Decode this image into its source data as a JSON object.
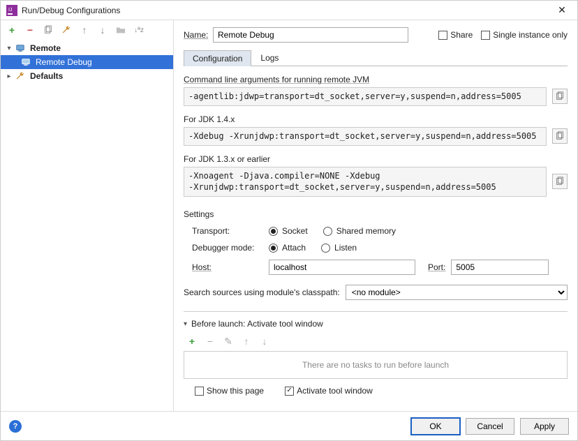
{
  "window": {
    "title": "Run/Debug Configurations"
  },
  "sidebar": {
    "items": [
      {
        "label": "Remote",
        "expanded": true,
        "bold": true
      },
      {
        "label": "Remote Debug",
        "selected": true
      },
      {
        "label": "Defaults",
        "expanded": false,
        "bold": true
      }
    ]
  },
  "nameRow": {
    "label": "Name:",
    "value": "Remote Debug",
    "shareLabel": "Share",
    "shareChecked": false,
    "singleInstanceLabel": "Single instance only",
    "singleInstanceChecked": false
  },
  "tabs": [
    "Configuration",
    "Logs"
  ],
  "activeTab": 0,
  "cmdline": {
    "label": "Command line arguments for running remote JVM",
    "value": "-agentlib:jdwp=transport=dt_socket,server=y,suspend=n,address=5005"
  },
  "jdk14": {
    "label": "For JDK 1.4.x",
    "value": "-Xdebug -Xrunjdwp:transport=dt_socket,server=y,suspend=n,address=5005"
  },
  "jdk13": {
    "label": "For JDK 1.3.x or earlier",
    "value": "-Xnoagent -Djava.compiler=NONE -Xdebug\n-Xrunjdwp:transport=dt_socket,server=y,suspend=n,address=5005"
  },
  "settings": {
    "title": "Settings",
    "transportLabel": "Transport:",
    "transportOptions": [
      "Socket",
      "Shared memory"
    ],
    "transportSelected": 0,
    "debuggerLabel": "Debugger mode:",
    "debuggerOptions": [
      "Attach",
      "Listen"
    ],
    "debuggerSelected": 0,
    "hostLabel": "Host:",
    "hostValue": "localhost",
    "portLabel": "Port:",
    "portValue": "5005"
  },
  "module": {
    "label": "Search sources using module's classpath:",
    "value": "<no module>"
  },
  "beforeLaunch": {
    "header": "Before launch: Activate tool window",
    "emptyText": "There are no tasks to run before launch",
    "showThisPageLabel": "Show this page",
    "showThisPageChecked": false,
    "activateLabel": "Activate tool window",
    "activateChecked": true
  },
  "footer": {
    "ok": "OK",
    "cancel": "Cancel",
    "apply": "Apply"
  }
}
